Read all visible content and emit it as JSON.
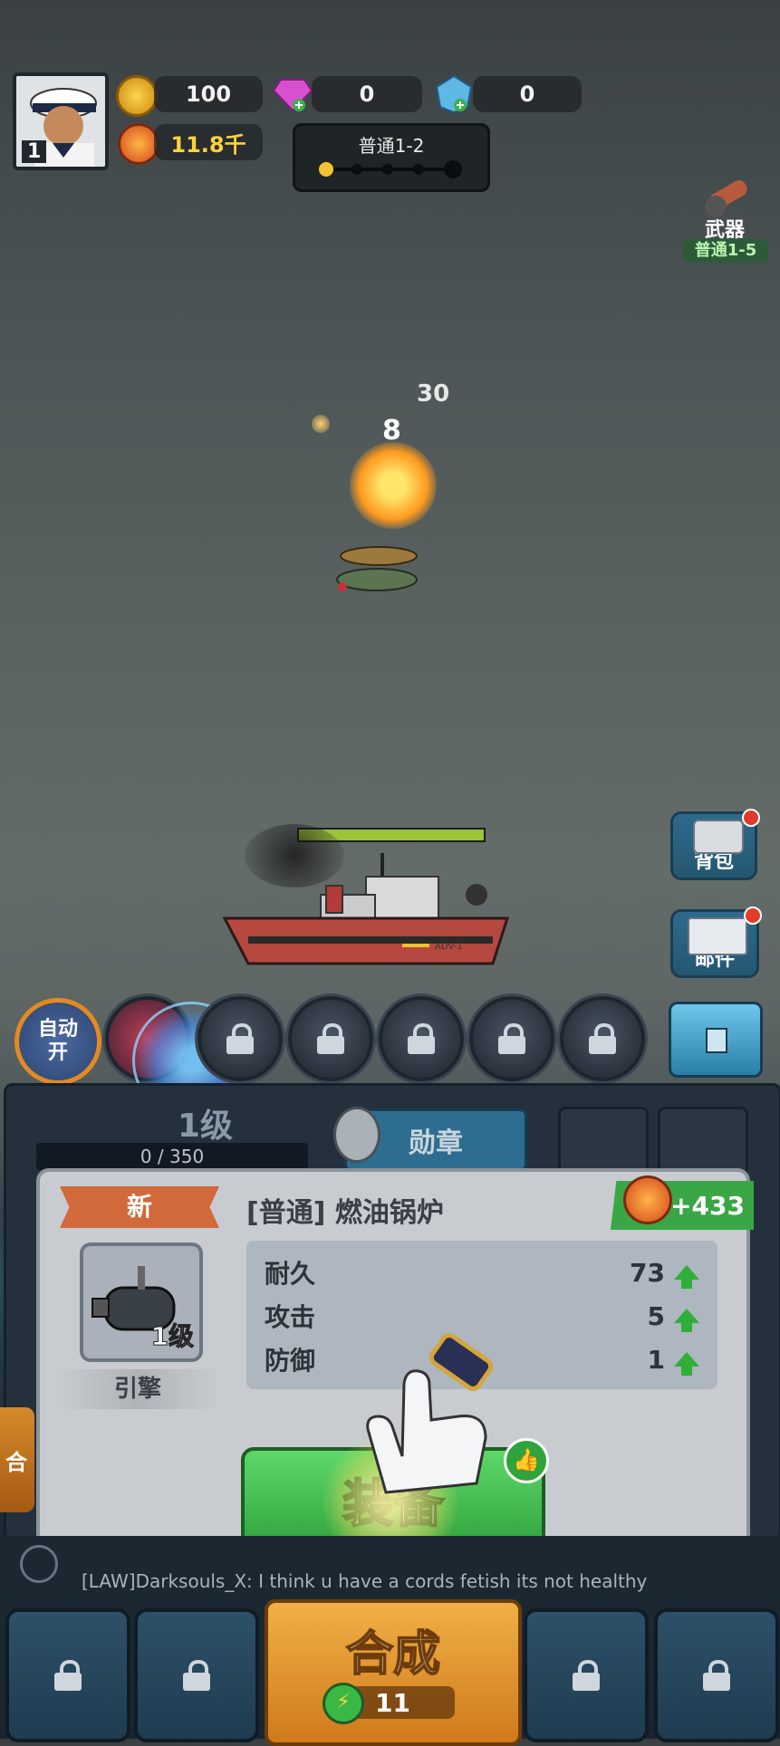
{
  "player": {
    "level": "1"
  },
  "currency": {
    "gold": "100",
    "gem_pink": "0",
    "gem_blue": "0",
    "power": "11.8千"
  },
  "stage": {
    "name": "普通1-2"
  },
  "weapon": {
    "label": "武器",
    "stage": "普通1-5"
  },
  "battle": {
    "damage_a": "30",
    "damage_b": "8"
  },
  "side_buttons": {
    "bag": "背包",
    "mail": "邮件"
  },
  "auto": {
    "line1": "自动",
    "line2": "开"
  },
  "ship": {
    "level": "1级",
    "exp": "0 / 350",
    "hull_text": "ADV-1"
  },
  "medal": {
    "label": "勋章"
  },
  "popup": {
    "tag": "新",
    "title": "[普通] 燃油锅炉",
    "power_gain": "+433",
    "item_level": "1级",
    "item_type": "引擎",
    "stats": [
      {
        "name": "耐久",
        "value": "73"
      },
      {
        "name": "攻击",
        "value": "5"
      },
      {
        "name": "防御",
        "value": "1"
      }
    ],
    "equip_label": "装备"
  },
  "chat": {
    "message": "[LAW]Darksouls_X:  I think u have a cords fetish its not healthy"
  },
  "merge": {
    "label": "合成",
    "cost": "11",
    "side_partial": "合"
  },
  "colors": {
    "green": "#3cbf4a",
    "orange": "#e39a2a",
    "panel": "#c8ccd1"
  }
}
